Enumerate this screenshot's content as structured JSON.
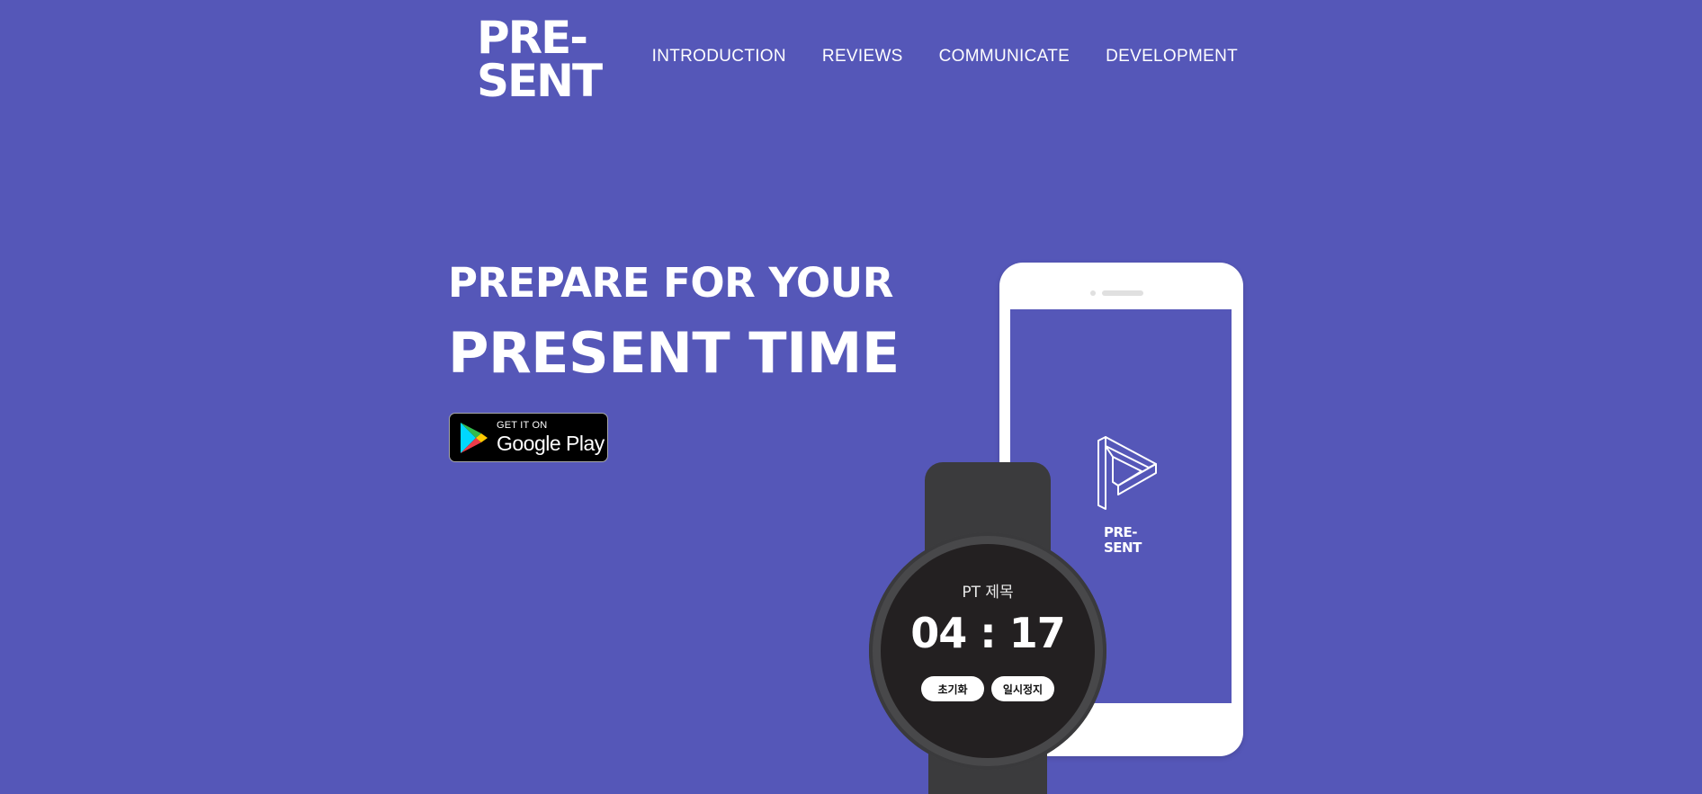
{
  "brand": {
    "line1": "PRE-",
    "line2": "SENT"
  },
  "nav": [
    {
      "label": "INTRODUCTION"
    },
    {
      "label": "REVIEWS"
    },
    {
      "label": "COMMUNICATE"
    },
    {
      "label": "DEVELOPMENT"
    }
  ],
  "hero": {
    "line1": "PREPARE FOR YOUR",
    "line2": "PRESENT TIME"
  },
  "store_badge": {
    "small": "GET IT ON",
    "big": "Google Play"
  },
  "phone": {
    "app_name_line1": "PRE-",
    "app_name_line2": "SENT"
  },
  "watch": {
    "title": "PT 제목",
    "time": "04 : 17",
    "reset_label": "초기화",
    "pause_label": "일시정지"
  },
  "colors": {
    "background": "#5557b8",
    "text": "#ffffff"
  }
}
